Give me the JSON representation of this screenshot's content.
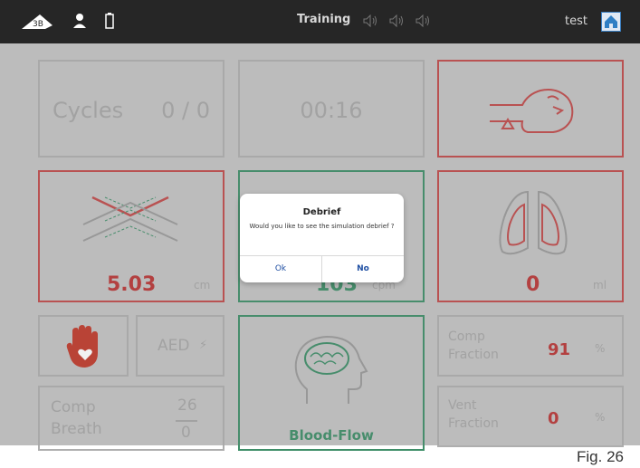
{
  "header": {
    "title": "Training",
    "user": "test",
    "icons": [
      "3b-logo-icon",
      "person-icon",
      "battery-icon",
      "speaker-icon",
      "speaker-icon",
      "speaker-icon",
      "home-icon"
    ]
  },
  "tiles": {
    "cycles": {
      "label": "Cycles",
      "value": "0 / 0"
    },
    "timer": {
      "value": "00:16"
    },
    "compression": {
      "depth": "5.03",
      "unit": "cm"
    },
    "rate": {
      "value": "103",
      "unit": "cpm"
    },
    "ventilation": {
      "value": "0",
      "unit": "ml"
    },
    "aed": {
      "label": "AED",
      "bolt": "⚡"
    },
    "comp_breath": {
      "label1": "Comp",
      "label2": "Breath",
      "num": "26",
      "den": "0"
    },
    "blood_flow": {
      "label": "Blood-Flow"
    },
    "comp_fraction": {
      "label1": "Comp",
      "label2": "Fraction",
      "value": "91",
      "unit": "%"
    },
    "vent_fraction": {
      "label1": "Vent",
      "label2": "Fraction",
      "value": "0",
      "unit": "%"
    }
  },
  "dialog": {
    "title": "Debrief",
    "message": "Would you like to see the simulation debrief ?",
    "ok": "Ok",
    "no": "No"
  },
  "figure_caption": "Fig. 26",
  "colors": {
    "red": "#c04a4a",
    "green": "#3e8e68",
    "dialog_blue": "#1f4fa3"
  }
}
